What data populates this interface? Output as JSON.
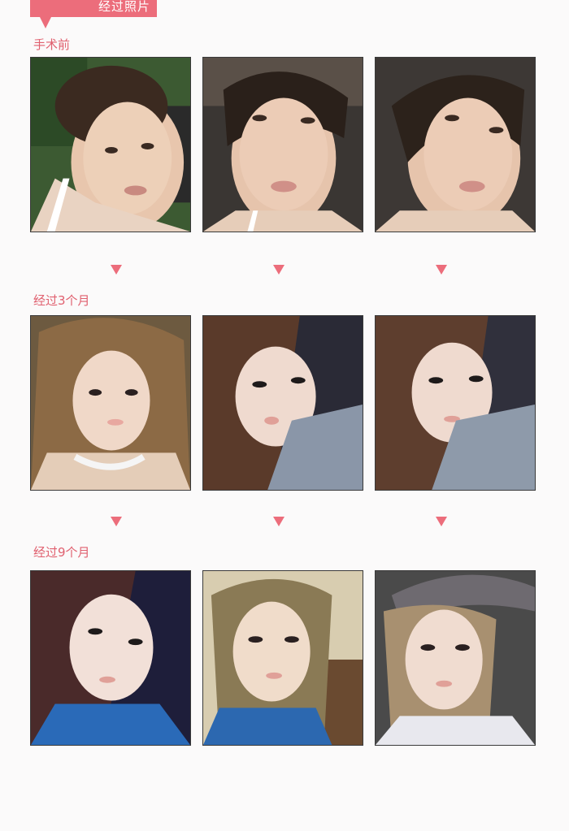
{
  "header": {
    "title": "经过照片",
    "color": "#ec6d7b"
  },
  "sections": [
    {
      "label": "手术前",
      "photos": [
        {
          "alt": "before-1"
        },
        {
          "alt": "before-2"
        },
        {
          "alt": "before-3"
        }
      ]
    },
    {
      "label": "经过3个月",
      "photos": [
        {
          "alt": "month3-1"
        },
        {
          "alt": "month3-2"
        },
        {
          "alt": "month3-3"
        }
      ]
    },
    {
      "label": "经过9个月",
      "photos": [
        {
          "alt": "month9-1"
        },
        {
          "alt": "month9-2"
        },
        {
          "alt": "month9-3"
        }
      ]
    }
  ],
  "colors": {
    "accent": "#ec6d7b",
    "label": "#e0606f",
    "background": "#fbfafa"
  }
}
